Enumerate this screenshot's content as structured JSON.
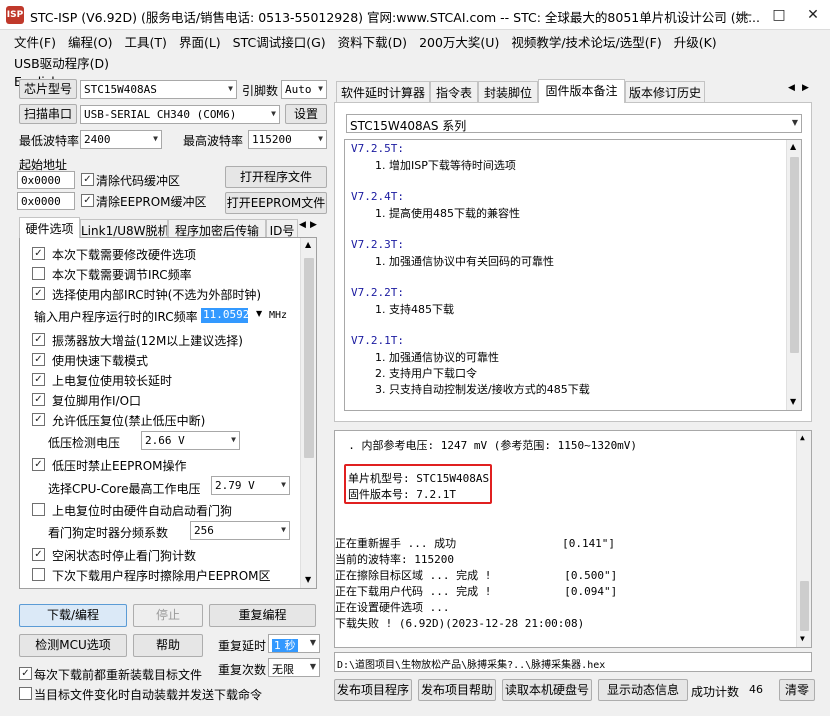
{
  "window": {
    "title": "STC-ISP (V6.92D) (服务电话/销售电话: 0513-55012928) 官网:www.STCAI.com  -- STC: 全球最大的8051单片机设计公司 (姚...",
    "controls": [
      "—",
      "□",
      "✕"
    ]
  },
  "menu": [
    "文件(F)",
    "编程(O)",
    "工具(T)",
    "界面(L)",
    "STC调试接口(G)",
    "资料下载(D)",
    "200万大奖(U)",
    "视频教学/技术论坛/选型(F)",
    "升级(K)",
    "USB驱动程序(D)",
    "English"
  ],
  "left": {
    "chip_btn": "芯片型号",
    "chip_value": "STC15W408AS",
    "pins_label": "引脚数",
    "pins_value": "Auto",
    "scan_btn": "扫描串口",
    "port_value": "USB-SERIAL CH340 (COM6)",
    "settings_btn": "设置",
    "min_baud_label": "最低波特率",
    "min_baud_value": "2400",
    "max_baud_label": "最高波特率",
    "max_baud_value": "115200",
    "start_addr_label": "起始地址",
    "addr1": "0x0000",
    "clear_code": "清除代码缓冲区",
    "open_prog_btn": "打开程序文件",
    "addr2": "0x0000",
    "clear_eeprom": "清除EEPROM缓冲区",
    "open_eeprom_btn": "打开EEPROM文件",
    "tabs": [
      "硬件选项",
      "Link1/U8W脱机",
      "程序加密后传输",
      "ID号"
    ],
    "options": {
      "o1": "本次下载需要修改硬件选项",
      "o2": "本次下载需要调节IRC频率",
      "o3": "选择使用内部IRC时钟(不选为外部时钟)",
      "o4_label": "输入用户程序运行时的IRC频率",
      "o4_value": "11.0592",
      "o4_unit": "MHz",
      "o5": "振荡器放大增益(12M以上建议选择)",
      "o6": "使用快速下载模式",
      "o7": "上电复位使用较长延时",
      "o8": "复位脚用作I/O口",
      "o9": "允许低压复位(禁止低压中断)",
      "o10_label": "低压检测电压",
      "o10_value": "2.66 V",
      "o11": "低压时禁止EEPROM操作",
      "o12_label": "选择CPU-Core最高工作电压",
      "o12_value": "2.79 V",
      "o13": "上电复位时由硬件自动启动看门狗",
      "o14_label": "看门狗定时器分频系数",
      "o14_value": "256",
      "o15": "空闲状态时停止看门狗计数",
      "o16": "下次下载用户程序时擦除用户EEPROM区"
    },
    "download_btn": "下载/编程",
    "stop_btn": "停止",
    "reprog_btn": "重复编程",
    "check_btn": "检测MCU选项",
    "help_btn": "帮助",
    "repeat_delay_label": "重复延时",
    "repeat_delay_value": "1 秒",
    "repeat_count_label": "重复次数",
    "repeat_count_value": "无限",
    "reload_chk": "每次下载前都重新装载目标文件",
    "auto_chk": "当目标文件变化时自动装载并发送下载命令"
  },
  "right": {
    "tabs": [
      "软件延时计算器",
      "指令表",
      "封装脚位",
      "固件版本备注",
      "版本修订历史"
    ],
    "series_value": "STC15W408AS 系列",
    "notes": [
      {
        "ver": "V7.2.5T:",
        "lines": [
          "1. 增加ISP下载等待时间选项"
        ]
      },
      {
        "ver": "V7.2.4T:",
        "lines": [
          "1. 提高使用485下载的兼容性"
        ]
      },
      {
        "ver": "V7.2.3T:",
        "lines": [
          "1. 加强通信协议中有关回码的可靠性"
        ]
      },
      {
        "ver": "V7.2.2T:",
        "lines": [
          "1. 支持485下载"
        ]
      },
      {
        "ver": "V7.2.1T:",
        "lines": [
          "1. 加强通信协议的可靠性",
          "2. 支持用户下载口令",
          "3. 只支持自动控制发送/接收方式的485下载"
        ]
      }
    ],
    "log": [
      "  . 内部参考电压: 1247 mV (参考范围: 1150~1320mV)",
      "",
      "单片机型号: STC15W408AS",
      "固件版本号: 7.2.1T",
      "",
      "",
      "正在重新握手 ... 成功                [0.141\"]",
      "当前的波特率: 115200",
      "正在擦除目标区域 ... 完成 !           [0.500\"]",
      "正在下载用户代码 ... 完成 !           [0.094\"]",
      "正在设置硬件选项 ...",
      "下载失败 ! (6.92D)(2023-12-28 21:00:08)"
    ],
    "path": "D:\\道图项目\\生物放松产品\\脉搏采集?..\\脉搏采集器.hex",
    "publish_prog_btn": "发布项目程序",
    "publish_help_btn": "发布项目帮助",
    "read_disk_btn": "读取本机硬盘号",
    "show_dyn_btn": "显示动态信息",
    "success_label": "成功计数",
    "success_count": "46",
    "clear_btn": "清零"
  },
  "colors": {
    "highlight_box": "#e02020",
    "selection": "#3399ff",
    "title_red": "#c0392b"
  }
}
